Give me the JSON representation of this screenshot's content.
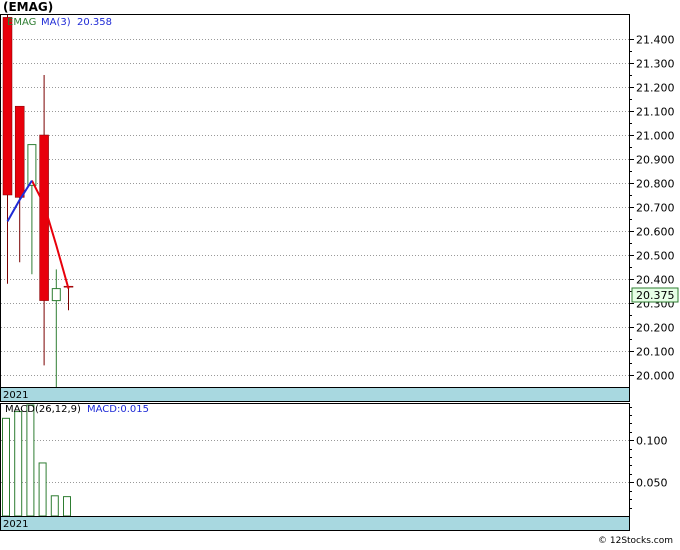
{
  "title": "(EMAG)",
  "credit": "© 12Stocks.com",
  "colors": {
    "up": "#2e7d32",
    "down": "#e8000b",
    "ma": "#e8000b",
    "ma_start": "#1f2bd6",
    "macd_bar": "#2e7d32",
    "date_band": "#a8d8e0",
    "price_badge": "#e6ffe6",
    "grid": "#999999"
  },
  "chart_data": [
    {
      "type": "candlestick",
      "title": "(EMAG)",
      "legend": {
        "symbol": "EMAG",
        "ma_label": "MA(3)",
        "ma_value": "20.358"
      },
      "x_label": "2021",
      "y_ticks": [
        "21.400",
        "21.300",
        "21.200",
        "21.100",
        "21.000",
        "20.900",
        "20.800",
        "20.700",
        "20.600",
        "20.500",
        "20.400",
        "20.300",
        "20.200",
        "20.100",
        "20.000"
      ],
      "ylim": [
        19.95,
        21.5
      ],
      "last_price_label": "20.375",
      "last_price": 20.375,
      "grid": true,
      "candles": [
        {
          "open": 20.75,
          "high": 21.5,
          "low": 20.38,
          "close": 21.49,
          "dir": "down"
        },
        {
          "open": 21.12,
          "high": 21.12,
          "low": 20.47,
          "close": 20.74,
          "dir": "down"
        },
        {
          "open": 20.79,
          "high": 20.96,
          "low": 20.42,
          "close": 20.96,
          "dir": "up"
        },
        {
          "open": 21.0,
          "high": 21.25,
          "low": 20.04,
          "close": 20.31,
          "dir": "down"
        },
        {
          "open": 20.31,
          "high": 20.44,
          "low": 19.95,
          "close": 20.36,
          "dir": "up"
        },
        {
          "open": 20.37,
          "high": 20.37,
          "low": 20.27,
          "close": 20.37,
          "dir": "down"
        }
      ],
      "ma": [
        20.64,
        20.73,
        20.81,
        20.71,
        20.54,
        20.36
      ]
    },
    {
      "type": "bar",
      "legend": {
        "label": "MACD(26,12,9)",
        "value_label": "MACD:0.015"
      },
      "x_label": "2021",
      "y_ticks": [
        "0.100",
        "0.050"
      ],
      "ylim": [
        0.01,
        0.143
      ],
      "values": [
        0.126,
        0.134,
        0.144,
        0.073,
        0.034,
        0.033
      ],
      "grid": true
    }
  ]
}
